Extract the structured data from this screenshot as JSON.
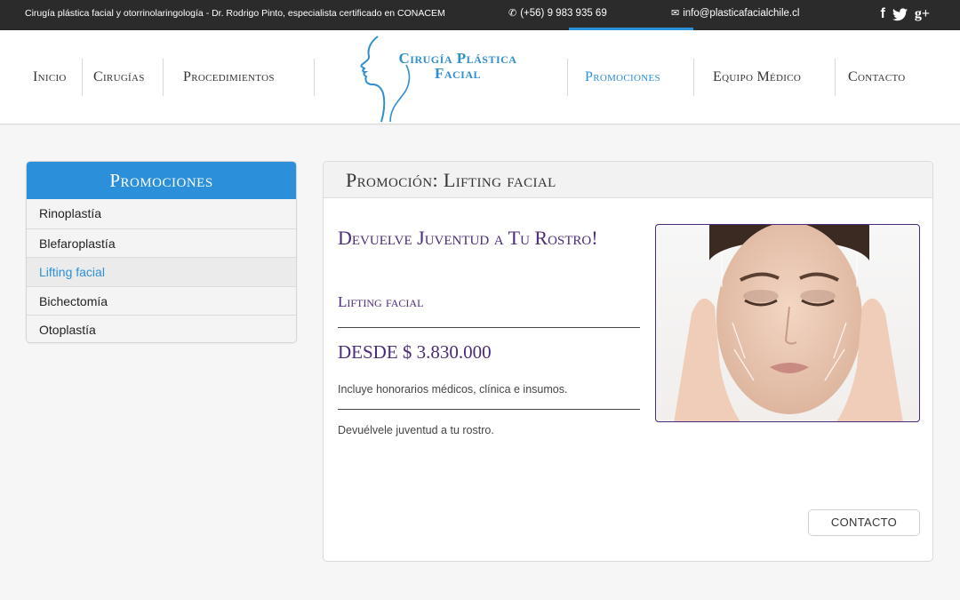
{
  "topbar": {
    "tagline": "Cirugía plástica facial y otorrinolaringología - Dr. Rodrigo Pinto, especialista certificado en CONACEM",
    "phone": "(+56) 9 983 935 69",
    "email": "info@plasticafacialchile.cl",
    "social": {
      "facebook": "f",
      "twitter": "🐦",
      "googleplus": "g+"
    },
    "icons": {
      "phone": "phone-icon",
      "email": "envelope-icon"
    }
  },
  "nav": {
    "inicio": "Inicio",
    "cirugias": "Cirugías",
    "procedimientos": "Procedimientos",
    "promociones": "Promociones",
    "equipo": "Equipo Médico",
    "contacto": "Contacto"
  },
  "logo": {
    "line1": "Cirugía Plástica",
    "line2": "Facial"
  },
  "sidebar": {
    "title": "Promociones",
    "items": [
      {
        "label": "Rinoplastía"
      },
      {
        "label": "Blefaroplastía"
      },
      {
        "label": "Lifting facial"
      },
      {
        "label": "Bichectomía"
      },
      {
        "label": "Otoplastía"
      }
    ],
    "active_index": 2
  },
  "main": {
    "heading": "Promoción: Lifting facial",
    "title": "Devuelve Juventud a Tu Rostro!",
    "subtitle": "Lifting facial",
    "price": "DESDE $ 3.830.000",
    "includes": "Incluye honorarios médicos, clínica e insumos.",
    "description": "Devuélvele juventud a tu rostro.",
    "contact_button": "CONTACTO"
  },
  "colors": {
    "accent": "#2b90d9",
    "purple": "#4a2a7a",
    "topbar": "#2b2b2b"
  }
}
